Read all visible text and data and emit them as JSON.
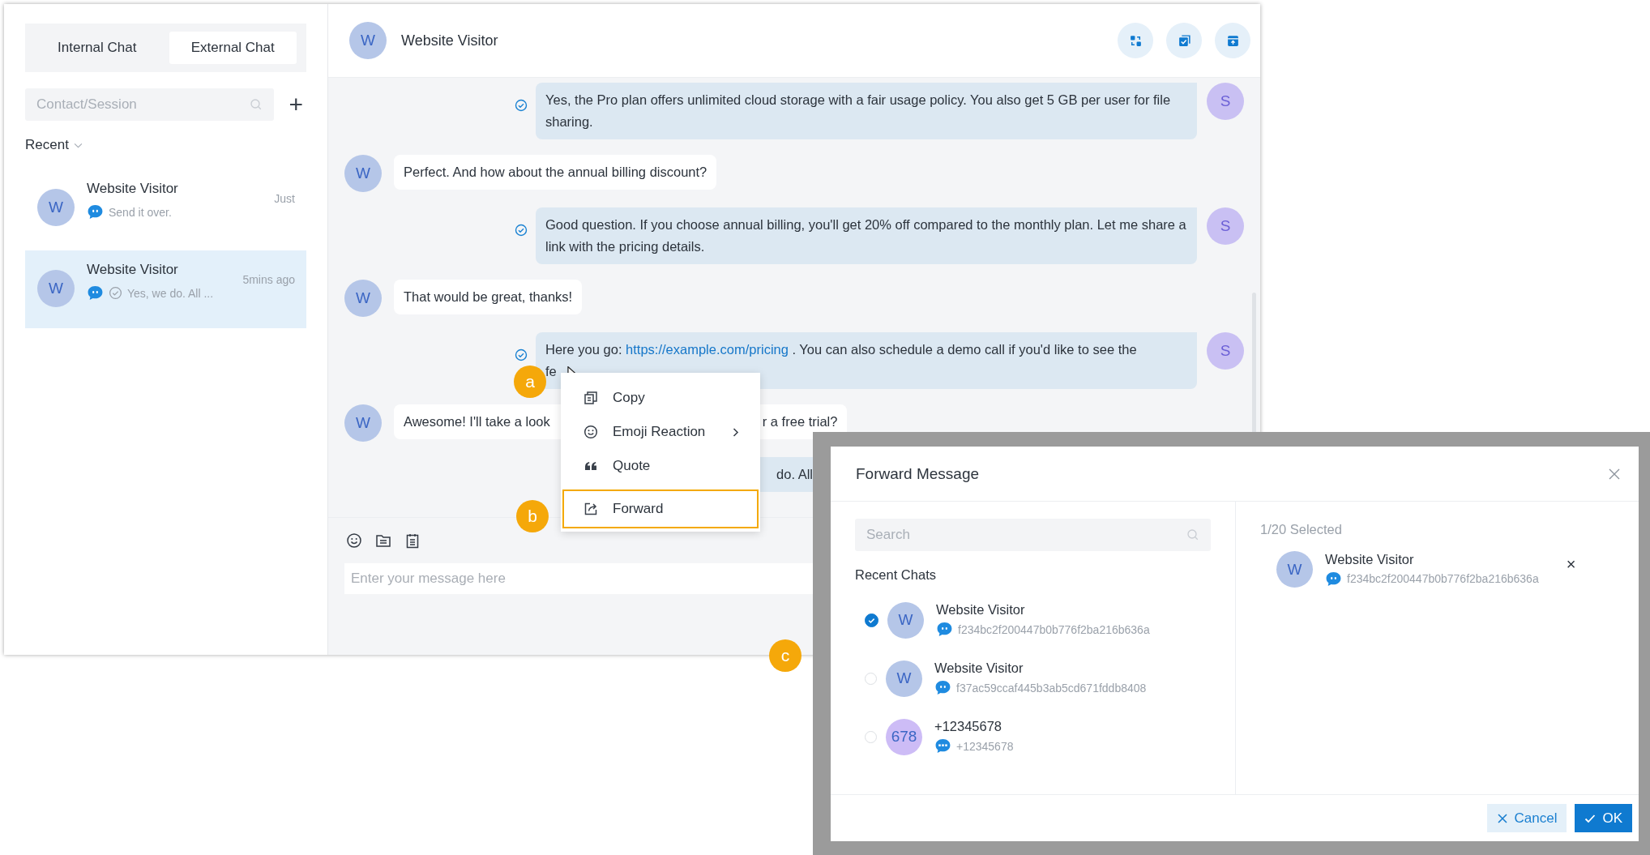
{
  "sidebar": {
    "tabs": [
      {
        "label": "Internal Chat",
        "selected": false
      },
      {
        "label": "External Chat",
        "selected": true
      }
    ],
    "search": {
      "placeholder": "Contact/Session"
    },
    "add_button": "+",
    "section": "Recent",
    "conversations": [
      {
        "initial": "W",
        "name": "Website Visitor",
        "time": "Just",
        "preview": "Send it over.",
        "read_receipt": false,
        "selected": false
      },
      {
        "initial": "W",
        "name": "Website Visitor",
        "time": "5mins ago",
        "preview": "Yes, we do. All ...",
        "read_receipt": true,
        "selected": true
      }
    ]
  },
  "chat": {
    "header": {
      "initial": "W",
      "name": "Website Visitor"
    },
    "messages": [
      {
        "kind": "out",
        "initial": "S",
        "parts": [
          {
            "kind": "text",
            "text": "Yes, the Pro plan offers unlimited cloud storage with a fair usage policy. You also get 5 GB per user for file sharing."
          }
        ]
      },
      {
        "kind": "in",
        "initial": "W",
        "parts": [
          {
            "kind": "text",
            "text": "Perfect. And how about the annual billing discount?"
          }
        ]
      },
      {
        "kind": "out",
        "initial": "S",
        "parts": [
          {
            "kind": "text",
            "text": "Good question. If you choose annual billing, you'll get 20% off compared to the monthly plan. Let me share a link with the pricing details."
          }
        ]
      },
      {
        "kind": "in",
        "initial": "W",
        "parts": [
          {
            "kind": "text",
            "text": "That would be great, thanks!"
          }
        ]
      },
      {
        "kind": "out",
        "initial": "S",
        "parts": [
          {
            "kind": "text",
            "text": "Here you go: "
          },
          {
            "kind": "link",
            "text": "https://example.com/pricing"
          },
          {
            "kind": "text",
            "text": " . You can also schedule a demo call if you'd like to see the"
          },
          {
            "kind": "break"
          },
          {
            "kind": "text",
            "text": "fe"
          }
        ]
      },
      {
        "kind": "in",
        "initial": "W",
        "parts": [
          {
            "kind": "text",
            "text": "Awesome! I'll take a look"
          },
          {
            "kind": "covered"
          },
          {
            "kind": "text",
            "text": "r a free trial?"
          }
        ]
      },
      {
        "kind": "out_covered",
        "parts": [
          {
            "kind": "covered_edge"
          },
          {
            "kind": "text",
            "text": "do. All"
          },
          {
            "kind": "covered_wide"
          }
        ]
      }
    ],
    "composer": {
      "placeholder": "Enter your message here"
    }
  },
  "context_menu": {
    "items": [
      {
        "kind": "copy",
        "label": "Copy",
        "submenu": false,
        "highlighted": false
      },
      {
        "kind": "emoji",
        "label": "Emoji Reaction",
        "submenu": true,
        "highlighted": false
      },
      {
        "kind": "quote",
        "label": "Quote",
        "submenu": false,
        "highlighted": false
      },
      {
        "kind": "forward",
        "label": "Forward",
        "submenu": false,
        "highlighted": true
      }
    ]
  },
  "callouts": [
    "a",
    "b",
    "c"
  ],
  "forward_dialog": {
    "title": "Forward Message",
    "search": {
      "placeholder": "Search"
    },
    "section": "Recent Chats",
    "chats": [
      {
        "initial": "W",
        "name": "Website Visitor",
        "id": "f234bc2f200447b0b776f2ba216b636a",
        "kind": "chat",
        "color": "#b5c6e8",
        "checked": true
      },
      {
        "initial": "W",
        "name": "Website Visitor",
        "id": "f37ac59ccaf445b3ab5cd671fddb8408",
        "kind": "chat",
        "color": "#b5c6e8",
        "checked": false
      },
      {
        "initial": "678",
        "name": "+12345678",
        "id": "+12345678",
        "kind": "sms",
        "color": "#cdbcf6",
        "checked": false
      }
    ],
    "selected_count": "1/20 Selected",
    "selected": [
      {
        "initial": "W",
        "name": "Website Visitor",
        "id": "f234bc2f200447b0b776f2ba216b636a",
        "kind": "chat",
        "remove": "×"
      }
    ],
    "buttons": {
      "cancel": "Cancel",
      "ok": "OK"
    }
  }
}
